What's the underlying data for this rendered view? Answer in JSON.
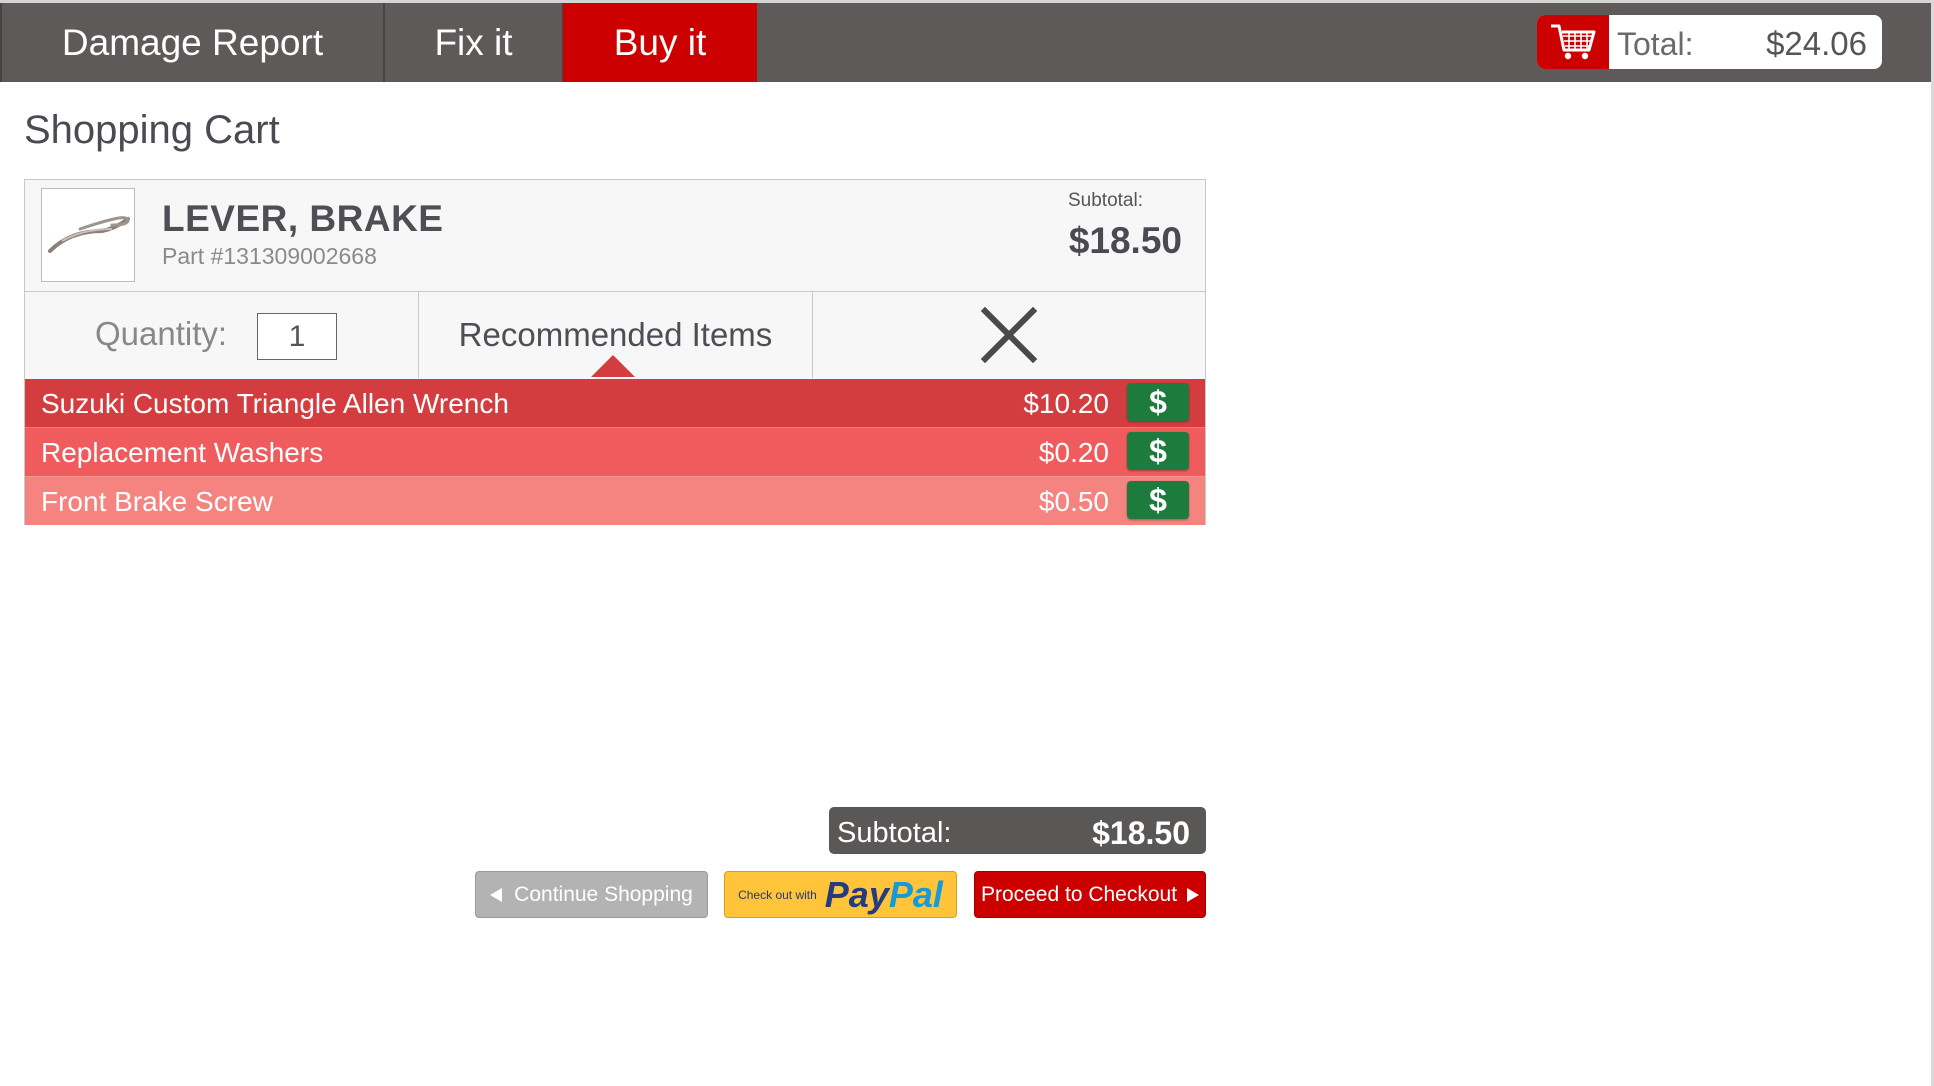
{
  "nav": {
    "tabs": [
      {
        "label": "Damage Report"
      },
      {
        "label": "Fix it"
      },
      {
        "label": "Buy it"
      }
    ],
    "active_tab": "Buy it",
    "cart": {
      "icon": "shopping-cart-icon",
      "total_label": "Total:",
      "total_value": "$24.06"
    }
  },
  "page": {
    "title": "Shopping Cart"
  },
  "cart_item": {
    "thumbnail_icon": "brake-lever-image",
    "name": "LEVER, BRAKE",
    "part_number": "Part #131309002668",
    "subtotal_label": "Subtotal:",
    "subtotal_value": "$18.50",
    "quantity_label": "Quantity:",
    "quantity_value": "1",
    "recommended_label": "Recommended Items",
    "remove_icon": "close-icon"
  },
  "recommended": [
    {
      "name": "Suzuki Custom Triangle Allen Wrench",
      "price": "$10.20",
      "buy_icon": "$"
    },
    {
      "name": "Replacement Washers",
      "price": "$0.20",
      "buy_icon": "$"
    },
    {
      "name": "Front Brake Screw",
      "price": "$0.50",
      "buy_icon": "$"
    }
  ],
  "summary": {
    "subtotal_label": "Subtotal:",
    "subtotal_value": "$18.50"
  },
  "actions": {
    "continue_label": "Continue Shopping",
    "paypal_prefix": "Check out with",
    "paypal_brand_pay": "Pay",
    "paypal_brand_pal": "Pal",
    "checkout_label": "Proceed to Checkout"
  },
  "colors": {
    "nav_bg": "#5d5a59",
    "accent": "#cc0000",
    "rec_row_1": "#d43d40",
    "rec_row_2": "#f05c5e",
    "rec_row_3": "#f58481",
    "buy_button": "#1d7b3d",
    "paypal_yellow": "#ffc43a"
  }
}
